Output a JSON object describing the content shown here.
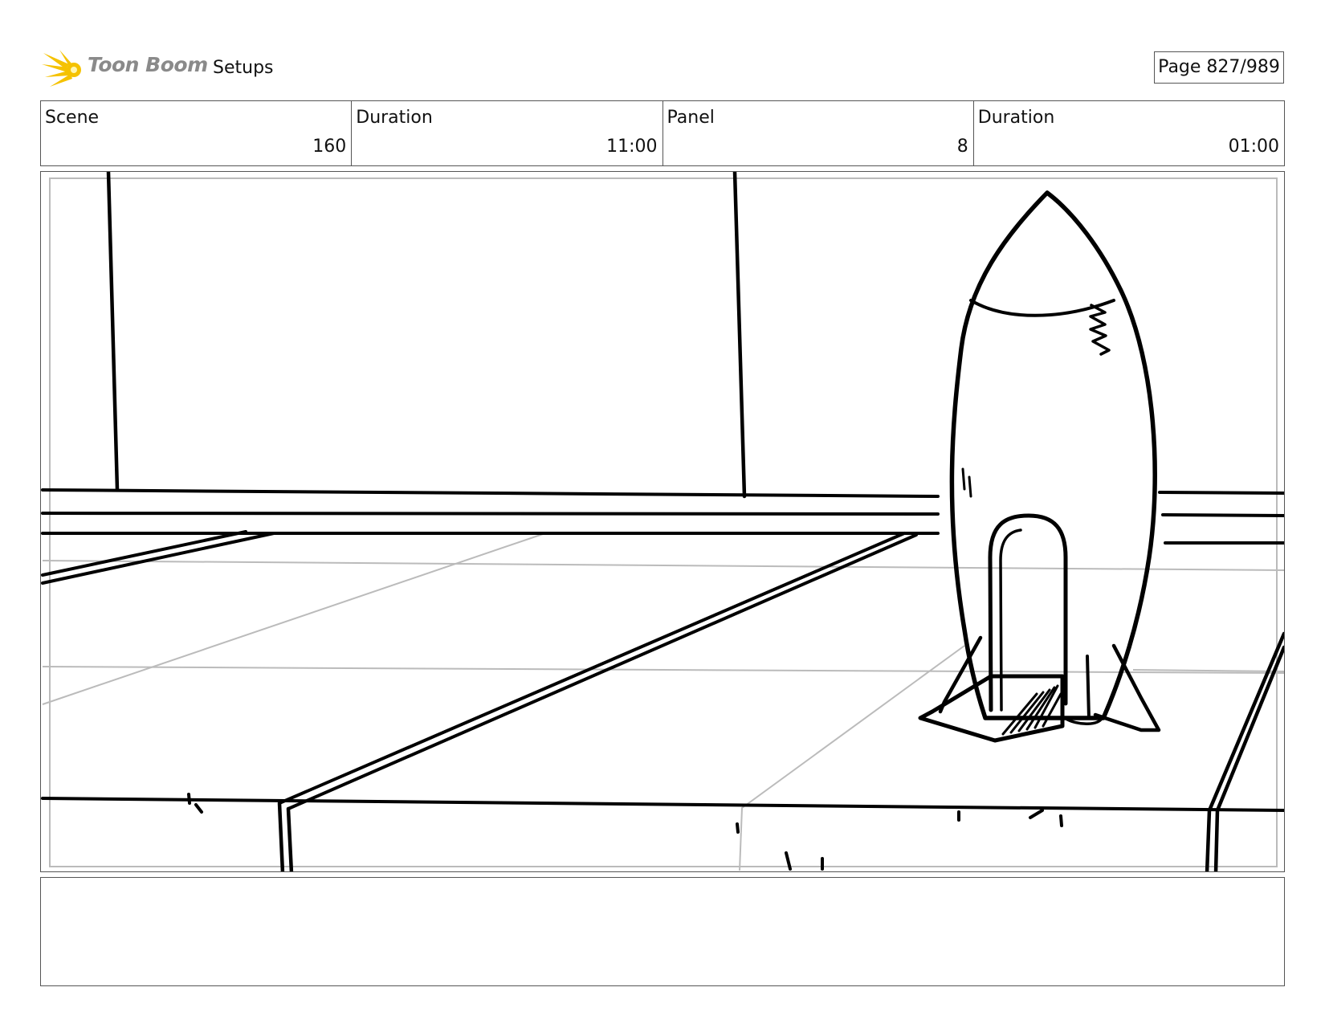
{
  "header": {
    "logo_text": "Toon Boom",
    "title": "Setups",
    "page": "Page 827/989"
  },
  "info": {
    "scene_label": "Scene",
    "scene_value": "160",
    "scene_duration_label": "Duration",
    "scene_duration_value": "11:00",
    "panel_label": "Panel",
    "panel_value": "8",
    "panel_duration_label": "Duration",
    "panel_duration_value": "01:00"
  },
  "panel": {
    "image_icon": "storyboard-sketch-rocket"
  },
  "caption": {
    "text": ""
  },
  "colors": {
    "logo_yellow": "#f5c200",
    "logo_text": "#8a8a8a",
    "border": "#555555",
    "guide_gray": "#bbbbbb"
  }
}
